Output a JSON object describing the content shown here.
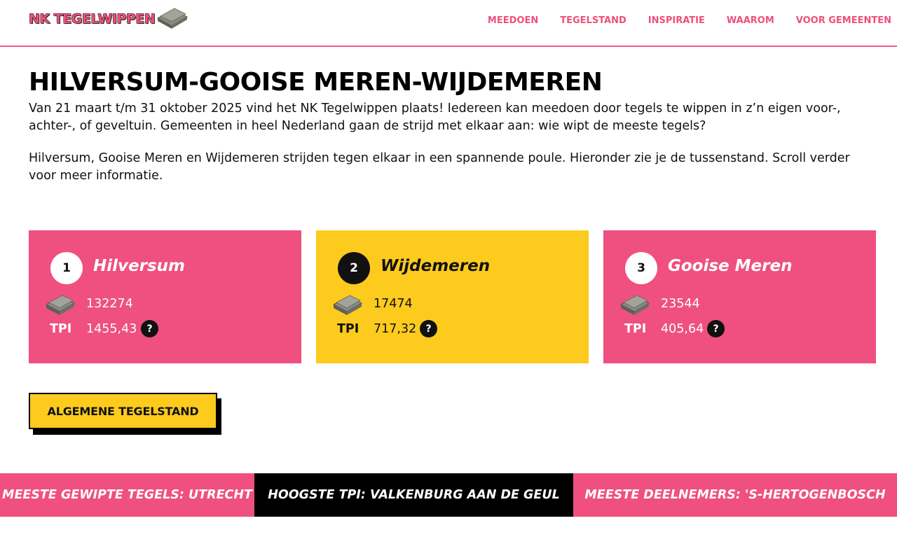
{
  "header": {
    "logo_text": "NK TEGELWIPPEN",
    "nav": [
      "MEEDOEN",
      "TEGELSTAND",
      "INSPIRATIE",
      "WAAROM",
      "VOOR GEMEENTEN"
    ]
  },
  "page": {
    "title": "HILVERSUM-GOOISE MEREN-WIJDEMEREN",
    "intro_1": "Van 21 maart t/m 31 oktober 2025 vind het NK Tegelwippen plaats! Iedereen kan meedoen door tegels te wippen in z’n eigen voor-, achter-, of geveltuin. Gemeenten in heel Nederland gaan de strijd met elkaar aan: wie wipt de meeste tegels?",
    "intro_2": "Hilversum, Gooise Meren en Wijdemeren strijden tegen elkaar in een spannende poule. Hieronder zie je de tussenstand. Scroll verder voor meer informatie."
  },
  "standings": [
    {
      "rank": "1",
      "name": "Hilversum",
      "tiles": "132274",
      "tpi_label": "TPI",
      "tpi": "1455,43",
      "help": "?"
    },
    {
      "rank": "2",
      "name": "Wijdemeren",
      "tiles": "17474",
      "tpi_label": "TPI",
      "tpi": "717,32",
      "help": "?"
    },
    {
      "rank": "3",
      "name": "Gooise Meren",
      "tiles": "23544",
      "tpi_label": "TPI",
      "tpi": "405,64",
      "help": "?"
    }
  ],
  "cta": {
    "label": "ALGEMENE TEGELSTAND"
  },
  "ticker": [
    "MEESTE GEWIPTE TEGELS: UTRECHT",
    "HOOGSTE TPI: VALKENBURG AAN DE GEUL",
    "MEESTE DEELNEMERS: 'S-HERTOGENBOSCH"
  ],
  "colors": {
    "pink": "#ef5080",
    "yellow": "#fccb1e",
    "black": "#000000",
    "white": "#ffffff"
  },
  "icons": {
    "tile": "tile-stack-icon",
    "help": "question-icon"
  }
}
